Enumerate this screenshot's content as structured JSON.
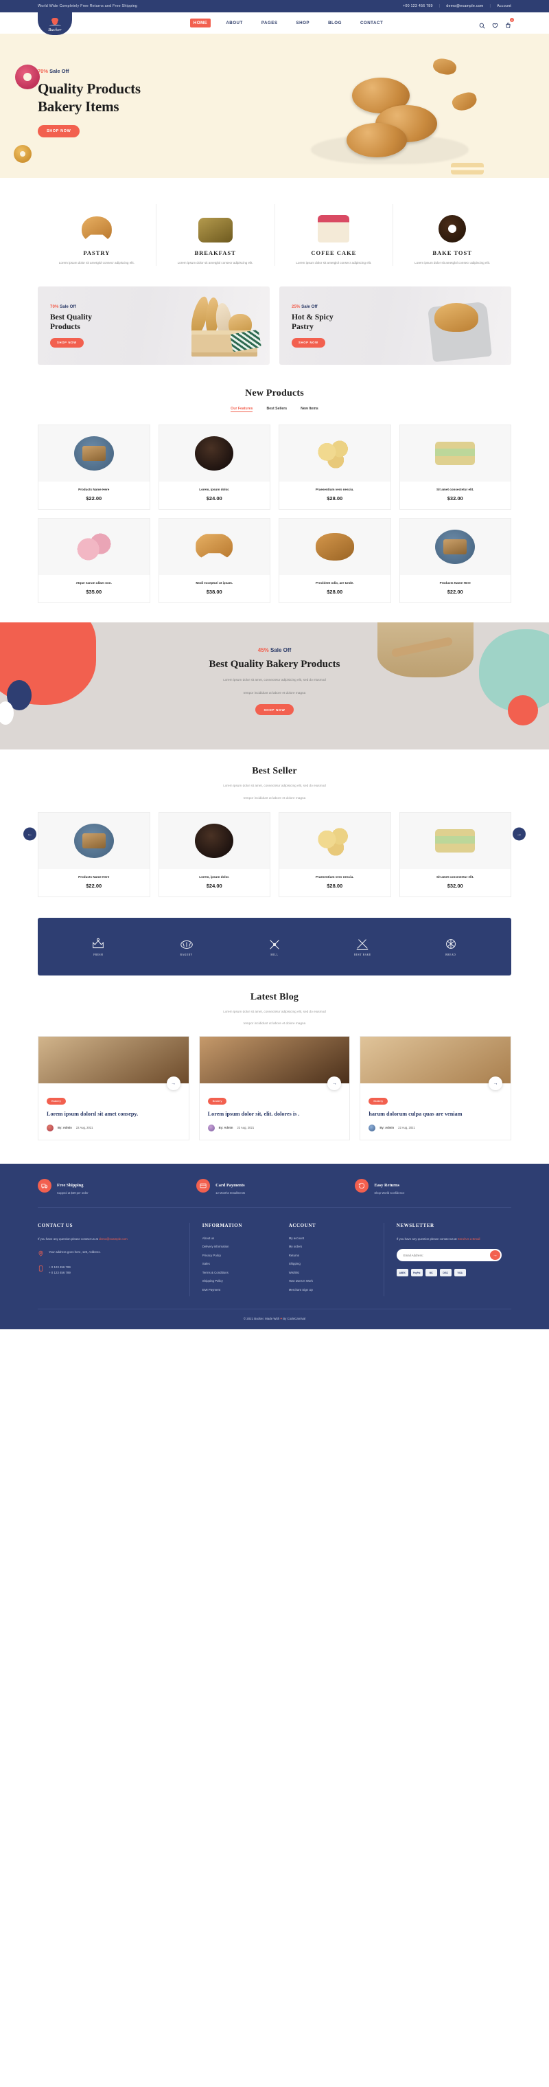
{
  "topbar": {
    "message": "World Wide Completely Free Returns and Free Shipping",
    "phone": "+00 123 456 789",
    "email": "demo@example.com",
    "account": "Account"
  },
  "header": {
    "brand": "Bucker",
    "nav": [
      {
        "label": "HOME",
        "active": true
      },
      {
        "label": "ABOUT",
        "active": false
      },
      {
        "label": "PAGES",
        "active": false
      },
      {
        "label": "SHOP",
        "active": false
      },
      {
        "label": "BLOG",
        "active": false
      },
      {
        "label": "CONTACT",
        "active": false
      }
    ],
    "icons": [
      "search-icon",
      "wishlist-icon",
      "cart-icon"
    ],
    "cart_count": "0"
  },
  "hero": {
    "sale_pct": "70%",
    "sale_text": "Sale Off",
    "title_line1": "Quality Products",
    "title_line2": "Bakery Items",
    "cta": "SHOP NOW"
  },
  "categories": [
    {
      "title": "PASTRY",
      "desc": "Lorem ipsum dolor sit ametglol consecr adipiscing elit."
    },
    {
      "title": "BREAKFAST",
      "desc": "Lorem ipsum dolor sit ametglol consecr adipiscing elit."
    },
    {
      "title": "COFEE CAKE",
      "desc": "Lorem ipsum dolor sit ametglol consecr adipiscing elit."
    },
    {
      "title": "BAKE TOST",
      "desc": "Lorem ipsum dolor sit ametglol consecr adipiscing elit."
    }
  ],
  "promos": [
    {
      "pct": "70%",
      "sale": "Sale Off",
      "line1": "Best Quality",
      "line2": "Products",
      "cta": "SHOP NOW"
    },
    {
      "pct": "25%",
      "sale": "Sale Off",
      "line1": "Hot & Spicy",
      "line2": "Pastry",
      "cta": "SHOP NOW"
    }
  ],
  "new_products": {
    "heading": "New Products",
    "tabs": [
      {
        "label": "Our Features",
        "active": true
      },
      {
        "label": "Best Sellers",
        "active": false
      },
      {
        "label": "New Items",
        "active": false
      }
    ],
    "items": [
      {
        "name": "Products Name Here",
        "price": "$22.00"
      },
      {
        "name": "Lorem, ipsum dolor.",
        "price": "$24.00"
      },
      {
        "name": "Praesentium vero nesciu.",
        "price": "$28.00"
      },
      {
        "name": "Sit amet consectetur elit.",
        "price": "$32.00"
      },
      {
        "name": "Atque earum ullam non.",
        "price": "$35.00"
      },
      {
        "name": "Modi excepturi ut ipsam.",
        "price": "$38.00"
      },
      {
        "name": "Provident odio, are Unde.",
        "price": "$28.00"
      },
      {
        "name": "Products Name Here",
        "price": "$22.00"
      }
    ]
  },
  "midcta": {
    "pct": "45%",
    "sale": "Sale Off",
    "heading": "Best Quality Bakery Products",
    "desc_line1": "Lorem ipsum dolor sit amet, consectetur adipisicing elit, sed do eiusmod",
    "desc_line2": "tempor incididunt ut labore et dolore magna",
    "cta": "SHOP NOW"
  },
  "best_seller": {
    "heading": "Best Seller",
    "desc_line1": "Lorem ipsum dolor sit amet, consectetur adipisicing elit, sed do eiusmod",
    "desc_line2": "tempor incididunt ut labore et dolore magna",
    "prev": "←",
    "next": "→",
    "items": [
      {
        "name": "Products Name Here",
        "price": "$22.00"
      },
      {
        "name": "Lorem, ipsum dolor.",
        "price": "$24.00"
      },
      {
        "name": "Praesentium vero nesciu.",
        "price": "$28.00"
      },
      {
        "name": "Sit amet consectetur elit.",
        "price": "$32.00"
      }
    ]
  },
  "brands": [
    {
      "name": "FRESH"
    },
    {
      "name": "BAKERY"
    },
    {
      "name": "MILL"
    },
    {
      "name": "BEST BAKE"
    },
    {
      "name": "BREAD"
    }
  ],
  "blog": {
    "heading": "Latest Blog",
    "desc_line1": "Lorem ipsum dolor sit amet, consectetur adipisicing elit, sed do eiusmod",
    "desc_line2": "tempor incididunt ut labore et dolore magna",
    "posts": [
      {
        "tag": "Brakery",
        "title": "Lorem ipsum dolorıl sit amet consepy.",
        "author": "By: Admin",
        "date": "22 Aug, 2021"
      },
      {
        "tag": "Brakery",
        "title": "Lorem ipsum dolor sit, elit. dolores is .",
        "author": "By: Admin",
        "date": "22 Aug, 2021"
      },
      {
        "tag": "Brakery",
        "title": "harum dolorum culpa quas are veniam",
        "author": "By: Admin",
        "date": "22 Aug, 2021"
      }
    ]
  },
  "footer": {
    "features": [
      {
        "title": "Free Shipping",
        "sub": "Capped at $39 per order",
        "icon": "shipping-icon"
      },
      {
        "title": "Card Payments",
        "sub": "12 Months Installments",
        "icon": "card-icon"
      },
      {
        "title": "Easy Returns",
        "sub": "Shop World Confidence",
        "icon": "returns-icon"
      }
    ],
    "contact": {
      "heading": "CONTACT US",
      "text_before": "If you have any question please contact us at ",
      "email": "demo@example.com",
      "address": "Your address goes here, 123, Address.",
      "phone1": "+ 0 123 456 789",
      "phone2": "+ 0 123 456 789"
    },
    "information": {
      "heading": "INFORMATION",
      "links": [
        "About us",
        "Delivery information",
        "Privacy Policy",
        "Sales",
        "Terms & Conditions",
        "Shipping Policy",
        "EMI Payment"
      ]
    },
    "account": {
      "heading": "ACCOUNT",
      "links": [
        "My account",
        "My orders",
        "Returns",
        "Shipping",
        "Wishlist",
        "How Does It Work",
        "Merchant Sign Up"
      ]
    },
    "newsletter": {
      "heading": "NEWSLETTER",
      "text_before": "If you have any question please contact us at ",
      "link": "Send Us a Email",
      "placeholder": "Email Address:",
      "value": "",
      "submit": "→",
      "cards": [
        "AMEX",
        "PayPal",
        "MC",
        "DISC",
        "VISA"
      ]
    },
    "copyright_pre": "© 2021 Bucker. Made With ",
    "copyright_heart": "♥",
    "copyright_post": " By CodeCarnival"
  },
  "colors": {
    "navy": "#2e3e72",
    "coral": "#f2604f",
    "cream": "#faf3e0"
  }
}
